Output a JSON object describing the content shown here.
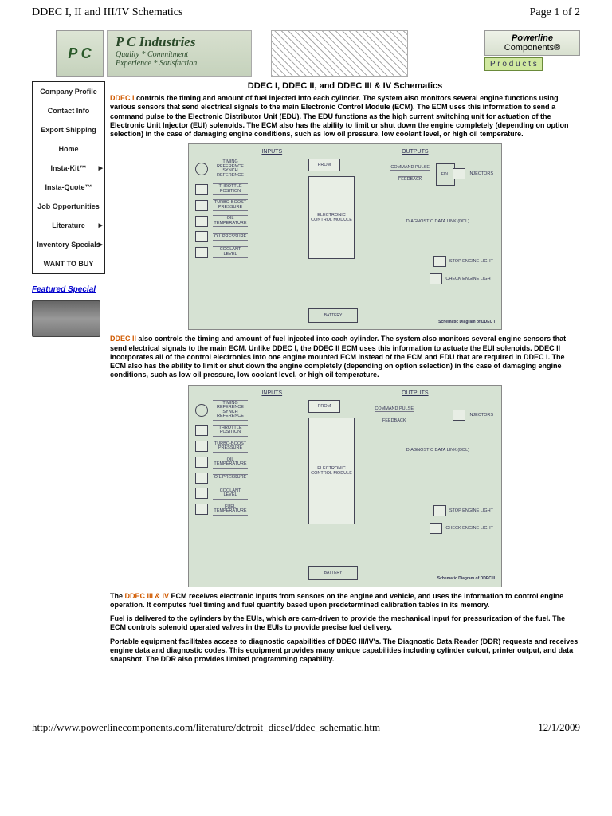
{
  "header": {
    "title": "DDEC I, II and III/IV Schematics",
    "page": "Page 1 of 2"
  },
  "banner": {
    "logo_text": "P C",
    "industries_title": "P C Industries",
    "industries_tag1": "Quality * Commitment",
    "industries_tag2": "Experience * Satisfaction",
    "powerline_bold": "Powerline",
    "powerline_reg": "Components®",
    "products": "P r o d u c t s"
  },
  "nav": {
    "items": [
      {
        "label": "Company Profile",
        "arrow": false
      },
      {
        "label": "Contact Info",
        "arrow": false
      },
      {
        "label": "Export Shipping",
        "arrow": false
      },
      {
        "label": "Home",
        "arrow": false
      },
      {
        "label": "Insta-Kit™",
        "arrow": true
      },
      {
        "label": "Insta-Quote™",
        "arrow": false
      },
      {
        "label": "Job Opportunities",
        "arrow": false
      },
      {
        "label": "Literature",
        "arrow": true
      },
      {
        "label": "Inventory Specials",
        "arrow": true
      },
      {
        "label": "WANT TO BUY",
        "arrow": false
      }
    ],
    "featured": "Featured Special"
  },
  "article": {
    "title": "DDEC I, DDEC II, and DDEC III & IV Schematics",
    "p1_label": "DDEC I",
    "p1": " controls the timing and amount of fuel injected into each cylinder. The system also monitors several engine functions using various sensors that send electrical signals to the main Electronic Control Module (ECM). The ECM uses this information to send a command pulse to the Electronic Distributor Unit (EDU). The EDU functions as the high current switching unit for actuation of the Electronic Unit Injector (EUI) solenoids. The ECM also has the ability to limit or shut down the engine completely (depending on option selection) in the case of damaging engine conditions, such as low oil pressure, low coolant level, or high oil temperature.",
    "p2_label": "DDEC II",
    "p2": " also controls the timing and amount of fuel injected into each cylinder. The system also monitors several engine sensors that send electrical signals to the main ECM. Unlike DDEC I, the DDEC II ECM uses this information to actuate the EUI solenoids. DDEC II incorporates all of the control electronics into one engine mounted ECM instead of the ECM and EDU that are required in DDEC I. The ECM also has the ability to limit or shut down the engine completely (depending on option selection) in the case of damaging engine conditions, such as low oil pressure, low coolant level, or high oil temperature.",
    "p3_pre": "The ",
    "p3_label": "DDEC III & IV",
    "p3": " ECM receives electronic inputs from sensors on the engine and vehicle, and uses the information to control engine operation. It computes fuel timing and fuel quantity based upon predetermined calibration tables in its memory.",
    "p4": "Fuel is delivered to the cylinders by the EUIs, which are cam-driven to provide the mechanical input for pressurization of the fuel. The ECM controls solenoid operated valves in the EUIs to provide precise fuel delivery.",
    "p5": "Portable equipment facilitates access to diagnostic capabilities of DDEC III/IV's. The Diagnostic Data Reader (DDR) requests and receives engine data and diagnostic codes. This equipment provides many unique capabilities including cylinder cutout, printer output, and data snapshot. The DDR also provides limited programming capability."
  },
  "schematic1": {
    "col_inputs": "INPUTS",
    "col_outputs": "OUTPUTS",
    "inputs": [
      "TIMING REFERENCE SYNCH REFERENCE",
      "THROTTLE POSITION",
      "TURBO-BOOST PRESSURE",
      "OIL TEMPERATURE",
      "OIL PRESSURE",
      "COOLANT LEVEL"
    ],
    "prom": "PROM",
    "ecm": "ELECTRONIC CONTROL MODULE",
    "cmd": "COMMAND PULSE",
    "fb": "FEEDBACK",
    "edu": "EDU",
    "inj": "INJECTORS",
    "ddl": "DIAGNOSTIC DATA LINK (DDL)",
    "stop": "STOP ENGINE LIGHT",
    "check": "CHECK ENGINE LIGHT",
    "battery": "BATTERY",
    "caption": "Schematic Diagram of DDEC I"
  },
  "schematic2": {
    "inputs": [
      "TIMING REFERENCE SYNCH REFERENCE",
      "THROTTLE POSITION",
      "TURBO-BOOST PRESSURE",
      "OIL TEMPERATURE",
      "OIL PRESSURE",
      "COOLANT LEVEL",
      "FUEL TEMPERATURE"
    ],
    "caption": "Schematic Diagram of DDEC II"
  },
  "footer": {
    "url": "http://www.powerlinecomponents.com/literature/detroit_diesel/ddec_schematic.htm",
    "date": "12/1/2009"
  }
}
